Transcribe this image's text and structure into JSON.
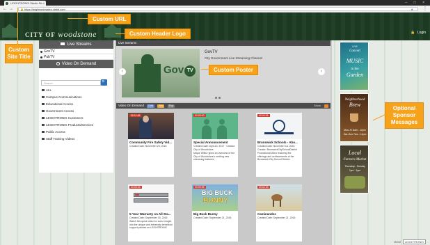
{
  "browser": {
    "tab_title": "LEIGHTRONIX Studio Str...",
    "tab_close": "×",
    "window_controls": "– □ ×",
    "url": "https://leightronixsales.viebit.com",
    "back": "←",
    "forward": "→",
    "lock": "🔒",
    "star": "★",
    "menu": "⋮"
  },
  "header": {
    "logo_prefix": "CITY OF",
    "logo_script": "woodstone",
    "login_label": "Login",
    "lock_icon": "🔒"
  },
  "sidebar": {
    "live_title": "Live Streams",
    "channels": [
      "GovTV",
      "PubTV"
    ],
    "vod_title": "Video On Demand",
    "search_placeholder": "Search",
    "search_button": "🔍",
    "categories": [
      "ALL",
      "Campus Communications",
      "Educational Access",
      "Government Access",
      "LEIGHTRONIX Customers",
      "LEIGHTRONIX Products/Services",
      "Public Access",
      "Staff Training Videos"
    ]
  },
  "live": {
    "header": "Live Streams",
    "poster_word": "Gov",
    "poster_badge": "TV",
    "channel_title": "GovTV",
    "channel_desc": "City Government Live Streaming Channel",
    "prev": "‹",
    "next": "›"
  },
  "vod": {
    "header": "Video On Demand",
    "tag_grid": "Grid",
    "tag_recent": "Rec",
    "tag_popular": "Pop",
    "show_label": "Show",
    "cards": [
      {
        "duration": "00:11:48",
        "title": "Community Fire Safety Vid...",
        "meta": "Created Date: November 29, 2016",
        "desc": ""
      },
      {
        "duration": "00:05:00",
        "title": "Special Announcement",
        "meta": "Created Date: April 20, 2017 · Creator: City of Woodstone",
        "desc": "Mayor Wilbur gives an overview of the City of Woodstone's exciting new streaming features!"
      },
      {
        "duration": "00:04:36",
        "title": "Brunswick Schools - Abo...",
        "meta": "Created Date: November 16, 2016 · Creator: BrunswickCitySchoolDistrict",
        "desc": "Promotional video featuring the offerings and achievements of the Brunswick City School District."
      },
      {
        "duration": "00:05:04",
        "title": "5-Year Warranty on All Sta...",
        "meta": "Created Date: September 30, 2016",
        "desc": "Watch this quick video for some insight into the unique and extremely beneficial support policies on LEIGHTRONIX"
      },
      {
        "duration": "00:09:56",
        "title": "Big Buck Bunny",
        "meta": "Created Date: September 21, 2016",
        "desc": ""
      },
      {
        "duration": "00:02:33",
        "title": "Caminandes",
        "meta": "Created Date: September 21, 2016",
        "desc": ""
      }
    ]
  },
  "sponsors": [
    {
      "l1": "LIVE",
      "l2": "Concert",
      "l3": "MUSIC",
      "l4": "in the",
      "l5": "Garden"
    },
    {
      "l1": "Neighborhood",
      "l2": "Brew",
      "l3": "Mon–Fr 6am - 10pm",
      "l4": "Sat–Sun 7am - 11pm",
      "l5": ""
    },
    {
      "l1": "Local",
      "l2": "Farmers Market",
      "l3": "Thursday - Sunday",
      "l4": "7pm - 1pm",
      "l5": ""
    }
  ],
  "callouts": {
    "url": "Custom URL",
    "logo": "Custom Header Logo",
    "site_title": "Custom Site Title",
    "poster": "Custom Poster",
    "sponsor": "Optional Sponsor Messages"
  },
  "footer": {
    "brand": "Viebit",
    "badge": "LEIGHTRONIX"
  },
  "colors": {
    "header_green": "#1c3a22",
    "accent_orange": "#f6a21b",
    "link_blue": "#2d6fbf"
  }
}
